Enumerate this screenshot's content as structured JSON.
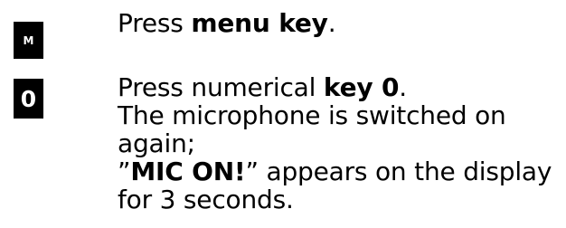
{
  "steps": [
    {
      "key_label": "M",
      "pre": "Press ",
      "bold": "menu key",
      "post": "."
    },
    {
      "key_label": "0",
      "pre": "Press numerical ",
      "bold": "key 0",
      "post": ".",
      "line2": "The microphone is switched on",
      "line3": "again;",
      "quote_open": "”",
      "quote_bold": "MIC ON!",
      "quote_rest": "” appears on the display",
      "line5": "for 3 seconds."
    }
  ]
}
